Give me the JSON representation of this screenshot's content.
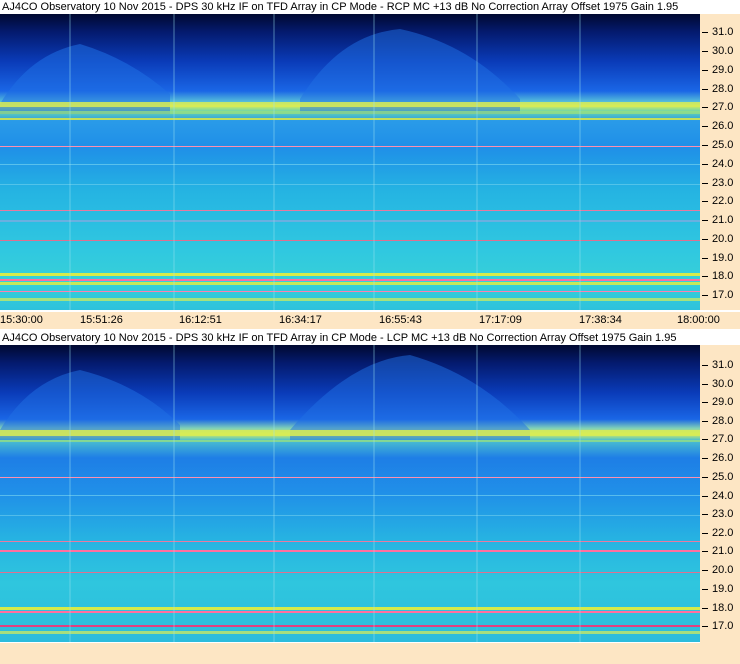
{
  "panels": [
    {
      "title": "AJ4CO Observatory 10 Nov 2015 - DPS 30 kHz IF on TFD Array in CP Mode - RCP  MC +13 dB  No Correction Array  Offset 1975  Gain 1.95",
      "polarization": "RCP"
    },
    {
      "title": "AJ4CO Observatory 10 Nov 2015 - DPS 30 kHz IF on TFD Array in CP Mode - LCP  MC +13 dB  No Correction Array  Offset 1975  Gain 1.95",
      "polarization": "LCP"
    }
  ],
  "y_axis": {
    "ticks": [
      "31.0",
      "30.0",
      "29.0",
      "28.0",
      "27.0",
      "26.0",
      "25.0",
      "24.0",
      "23.0",
      "22.0",
      "21.0",
      "20.0",
      "19.0",
      "18.0",
      "17.0"
    ]
  },
  "x_axis": {
    "ticks": [
      "15:30:00",
      "15:51:26",
      "16:12:51",
      "16:34:17",
      "16:55:43",
      "17:17:09",
      "17:38:34",
      "18:00:00"
    ]
  },
  "colors": {
    "axis_background": "#fde6c4",
    "low": "#000a3c",
    "mid": "#1a5be0",
    "high": "#2fd0e8",
    "peak": "#e8ef3a"
  }
}
